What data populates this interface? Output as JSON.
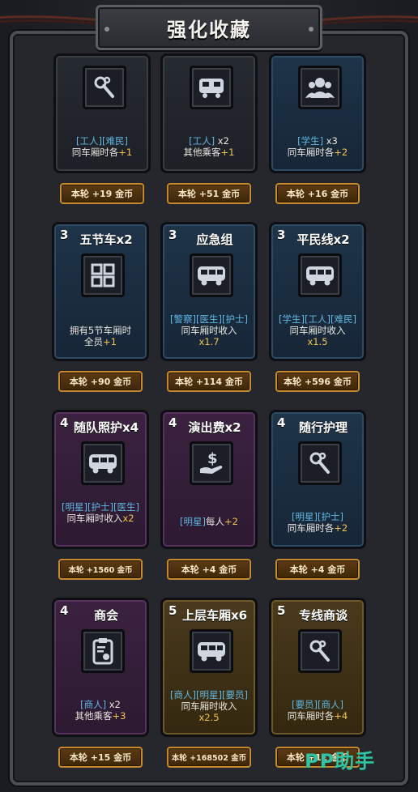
{
  "title": "强化收藏",
  "watermark": "PP助手",
  "cards": [
    {
      "level": "",
      "name": "",
      "icon": "wrench-icon",
      "style": "dark",
      "desc_tags": "[工人][难民]",
      "desc_text": "同车厢时各",
      "desc_plus": "+1",
      "desc_extra": "",
      "reward": "本轮 +19 金币"
    },
    {
      "level": "",
      "name": "",
      "icon": "carriage-link-icon",
      "style": "dark",
      "desc_tags": "[工人]",
      "desc_after_tags": " x2",
      "desc_text": "其他乘客",
      "desc_plus": "+1",
      "desc_extra": "",
      "reward": "本轮 +51 金币"
    },
    {
      "level": "",
      "name": "",
      "icon": "group-icon",
      "style": "blue",
      "desc_tags": "[学生]",
      "desc_after_tags": " x3",
      "desc_text": "同车厢时各",
      "desc_plus": "+2",
      "desc_extra": "",
      "reward": "本轮 +16 金币"
    },
    {
      "level": "3",
      "name": "五节车x2",
      "icon": "grid-icon",
      "style": "blue",
      "desc_tags": "",
      "desc_text": "拥有5节车厢时全员",
      "desc_plus": "+1",
      "desc_extra": "",
      "reward": "本轮 +90 金币"
    },
    {
      "level": "3",
      "name": "应急组",
      "icon": "bus-icon",
      "style": "blue",
      "desc_tags": "[警察][医生][护士]",
      "desc_text": "同车厢时收入",
      "desc_plus": "",
      "desc_extra": "x1.7",
      "reward": "本轮 +114 金币"
    },
    {
      "level": "3",
      "name": "平民线x2",
      "icon": "bus-icon",
      "style": "blue",
      "desc_tags": "[学生][工人][难民]",
      "desc_text": "同车厢时收入",
      "desc_plus": "",
      "desc_extra": "x1.5",
      "reward": "本轮 +596 金币"
    },
    {
      "level": "4",
      "name": "随队照护x4",
      "icon": "bus-icon",
      "style": "purple",
      "desc_tags": "[明星][护士][医生]",
      "desc_text": "同车厢时收入",
      "desc_plus": "x2",
      "desc_extra": "",
      "reward": "本轮 +1560 金币"
    },
    {
      "level": "4",
      "name": "演出费x2",
      "icon": "money-hand-icon",
      "style": "purple",
      "desc_tags": "[明星]",
      "desc_text": "每人",
      "desc_plus": "+2",
      "desc_extra": "",
      "reward": "本轮 +4 金币"
    },
    {
      "level": "4",
      "name": "随行护理",
      "icon": "wrench-icon",
      "style": "blue",
      "desc_tags": "[明星][护士]",
      "desc_text": "同车厢时各",
      "desc_plus": "+2",
      "desc_extra": "",
      "reward": "本轮 +4 金币"
    },
    {
      "level": "4",
      "name": "商会",
      "icon": "badge-icon",
      "style": "purple",
      "desc_tags": "[商人]",
      "desc_after_tags": " x2",
      "desc_text": "其他乘客",
      "desc_plus": "+3",
      "desc_extra": "",
      "reward": "本轮 +15 金币"
    },
    {
      "level": "5",
      "name": "上层车厢x6",
      "icon": "bus-icon",
      "style": "gold",
      "desc_tags": "[商人][明星][要员]",
      "desc_text": "同车厢时收入",
      "desc_plus": "",
      "desc_extra": "x2.5",
      "reward": "本轮 +168502 金币"
    },
    {
      "level": "5",
      "name": "专线商谈",
      "icon": "wrench-icon",
      "style": "gold",
      "desc_tags": "[要员][商人]",
      "desc_text": "同车厢时各",
      "desc_plus": "+4",
      "desc_extra": "",
      "reward": "本轮 +12 金币"
    }
  ]
}
